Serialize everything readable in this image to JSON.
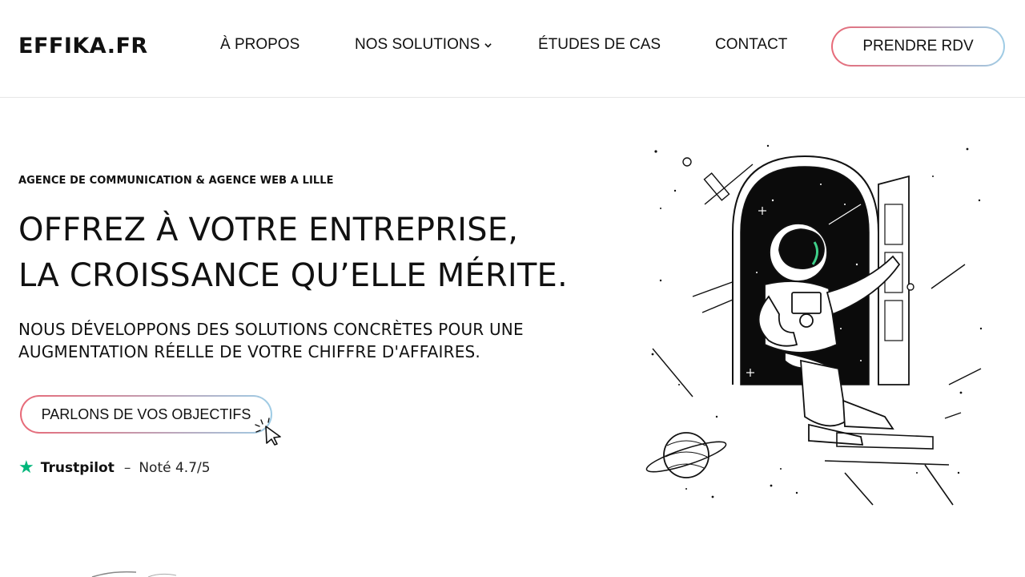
{
  "header": {
    "logo": "EFFIKA.FR",
    "nav": [
      {
        "label": "À PROPOS"
      },
      {
        "label": "NOS SOLUTIONS",
        "icon": "chevron-down-icon"
      },
      {
        "label": "ÉTUDES DE CAS"
      },
      {
        "label": "CONTACT"
      }
    ],
    "cta_label": "PRENDRE RDV"
  },
  "hero": {
    "eyebrow": "AGENCE DE COMMUNICATION & AGENCE WEB A LILLE",
    "headline_line1": "OFFREZ À VOTRE ENTREPRISE,",
    "headline_line2": "LA CROISSANCE QU’ELLE MÉRITE.",
    "subtitle_line1": "NOUS DÉVELOPPONS DES SOLUTIONS CONCRÈTES POUR UNE",
    "subtitle_line2": "AUGMENTATION RÉELLE DE VOTRE CHIFFRE D'AFFAIRES.",
    "button_label": "PARLONS DE VOS OBJECTIFS",
    "trust_brand": "Trustpilot",
    "trust_sep": "–",
    "trust_rating": "Noté 4.7/5"
  },
  "colors": {
    "gradient_start": "#e86a78",
    "gradient_end": "#9fcde6",
    "trustpilot_green": "#00b67a",
    "visor_accent": "#3fd08a"
  },
  "illustration": {
    "subject": "astronaut-sitting-in-open-door-to-space",
    "icons": [
      "planet-icon",
      "star-icon"
    ]
  }
}
